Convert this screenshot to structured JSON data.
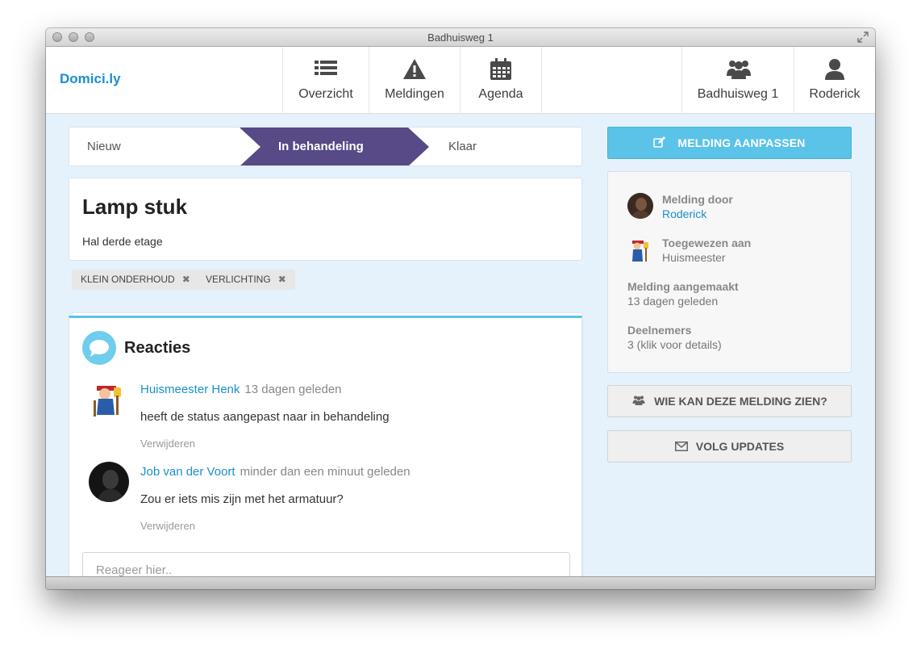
{
  "window": {
    "title": "Badhuisweg 1"
  },
  "brand": "Domici.ly",
  "nav": {
    "left": [
      {
        "label": "Overzicht",
        "icon": "list-icon"
      },
      {
        "label": "Meldingen",
        "icon": "warning-icon"
      },
      {
        "label": "Agenda",
        "icon": "calendar-icon"
      }
    ],
    "right": [
      {
        "label": "Badhuisweg 1",
        "icon": "group-icon"
      },
      {
        "label": "Roderick",
        "icon": "user-icon"
      }
    ]
  },
  "status_steps": [
    {
      "label": "Nieuw",
      "active": false
    },
    {
      "label": "In behandeling",
      "active": true
    },
    {
      "label": "Klaar",
      "active": false
    }
  ],
  "issue": {
    "title": "Lamp stuk",
    "location": "Hal derde etage",
    "tags": [
      "KLEIN ONDERHOUD",
      "VERLICHTING"
    ]
  },
  "reactions": {
    "title": "Reacties",
    "comments": [
      {
        "author": "Huismeester Henk",
        "time": "13 dagen geleden",
        "text": "heeft de status aangepast naar in behandeling",
        "delete_label": "Verwijderen"
      },
      {
        "author": "Job van der Voort",
        "time": "minder dan een minuut geleden",
        "text": "Zou er iets mis zijn met het armatuur?",
        "delete_label": "Verwijderen"
      }
    ],
    "reply_placeholder": "Reageer hier.."
  },
  "sidebar": {
    "edit_button": "MELDING AANPASSEN",
    "reported_by": {
      "label": "Melding door",
      "value": "Roderick"
    },
    "assigned_to": {
      "label": "Toegewezen aan",
      "value": "Huismeester"
    },
    "created": {
      "label": "Melding aangemaakt",
      "value": "13 dagen geleden"
    },
    "participants": {
      "label": "Deelnemers",
      "value": "3 (klik voor details)"
    },
    "visibility_button": "WIE KAN DEZE MELDING ZIEN?",
    "follow_button": "VOLG UPDATES"
  },
  "colors": {
    "accent": "#1a8fce",
    "active_step": "#574a86",
    "primary_button": "#5bc3e8",
    "background": "#e5f1fb"
  }
}
